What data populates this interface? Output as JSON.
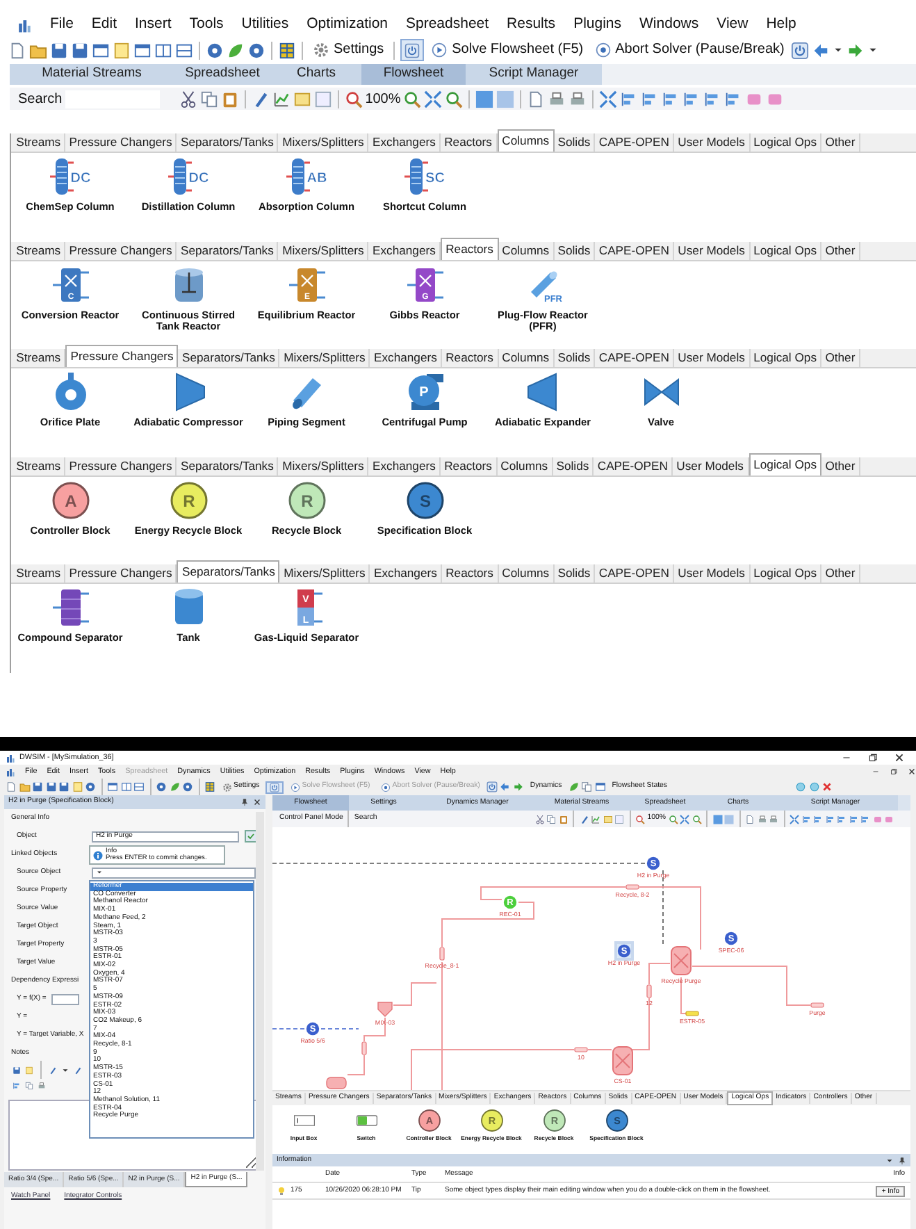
{
  "upper_window": {
    "menu": [
      "File",
      "Edit",
      "Insert",
      "Tools",
      "Utilities",
      "Optimization",
      "Spreadsheet",
      "Results",
      "Plugins",
      "Windows",
      "View",
      "Help"
    ],
    "toolbar": [
      "Settings",
      "Solve Flowsheet (F5)",
      "Abort Solver (Pause/Break)"
    ],
    "document_tabs": [
      {
        "label": "Material Streams",
        "selected": false
      },
      {
        "label": "Spreadsheet",
        "selected": false
      },
      {
        "label": "Charts",
        "selected": false
      },
      {
        "label": "Flowsheet",
        "selected": true
      },
      {
        "label": "Script Manager",
        "selected": false
      }
    ],
    "search_label": "Search",
    "zoom": "100%",
    "palettes": [
      {
        "tabs": [
          {
            "label": "Streams",
            "selected": false
          },
          {
            "label": "Pressure Changers",
            "selected": false
          },
          {
            "label": "Separators/Tanks",
            "selected": false
          },
          {
            "label": "Mixers/Splitters",
            "selected": false
          },
          {
            "label": "Exchangers",
            "selected": false
          },
          {
            "label": "Reactors",
            "selected": false
          },
          {
            "label": "Columns",
            "selected": true
          },
          {
            "label": "Solids",
            "selected": false
          },
          {
            "label": "CAPE-OPEN",
            "selected": false
          },
          {
            "label": "User Models",
            "selected": false
          },
          {
            "label": "Logical Ops",
            "selected": false
          },
          {
            "label": "Other",
            "selected": false
          }
        ],
        "items": [
          {
            "kind": "column",
            "glyphs": [
              "DC"
            ],
            "label": "ChemSep Column"
          },
          {
            "kind": "column",
            "glyphs": [
              "DC"
            ],
            "label": "Distillation Column"
          },
          {
            "kind": "column",
            "glyphs": [
              "AB"
            ],
            "label": "Absorption Column"
          },
          {
            "kind": "column",
            "glyphs": [
              "SC"
            ],
            "label": "Shortcut Column"
          }
        ]
      },
      {
        "tabs": [
          {
            "label": "Streams",
            "selected": false
          },
          {
            "label": "Pressure Changers",
            "selected": false
          },
          {
            "label": "Separators/Tanks",
            "selected": false
          },
          {
            "label": "Mixers/Splitters",
            "selected": false
          },
          {
            "label": "Exchangers",
            "selected": false
          },
          {
            "label": "Reactors",
            "selected": true
          },
          {
            "label": "Columns",
            "selected": false
          },
          {
            "label": "Solids",
            "selected": false
          },
          {
            "label": "CAPE-OPEN",
            "selected": false
          },
          {
            "label": "User Models",
            "selected": false
          },
          {
            "label": "Logical Ops",
            "selected": false
          },
          {
            "label": "Other",
            "selected": false
          }
        ],
        "items": [
          {
            "kind": "reactor",
            "color": "#3d78c0",
            "glyphs": [
              "C"
            ],
            "label": "Conversion Reactor"
          },
          {
            "kind": "stirred-tank",
            "label": "Continuous Stirred Tank Reactor"
          },
          {
            "kind": "reactor",
            "color": "#c8882c",
            "glyphs": [
              "E"
            ],
            "label": "Equilibrium Reactor"
          },
          {
            "kind": "reactor",
            "color": "#9448c8",
            "glyphs": [
              "G"
            ],
            "label": "Gibbs Reactor"
          },
          {
            "kind": "tube",
            "glyphs": [
              "PFR"
            ],
            "label": "Plug-Flow Reactor (PFR)"
          }
        ]
      },
      {
        "tabs": [
          {
            "label": "Streams",
            "selected": false
          },
          {
            "label": "Pressure Changers",
            "selected": true
          },
          {
            "label": "Separators/Tanks",
            "selected": false
          },
          {
            "label": "Mixers/Splitters",
            "selected": false
          },
          {
            "label": "Exchangers",
            "selected": false
          },
          {
            "label": "Reactors",
            "selected": false
          },
          {
            "label": "Columns",
            "selected": false
          },
          {
            "label": "Solids",
            "selected": false
          },
          {
            "label": "CAPE-OPEN",
            "selected": false
          },
          {
            "label": "User Models",
            "selected": false
          },
          {
            "label": "Logical Ops",
            "selected": false
          },
          {
            "label": "Other",
            "selected": false
          }
        ],
        "items": [
          {
            "kind": "orifice",
            "label": "Orifice Plate"
          },
          {
            "kind": "compressor",
            "label": "Adiabatic Compressor"
          },
          {
            "kind": "pipe",
            "label": "Piping Segment"
          },
          {
            "kind": "pump",
            "glyphs": [
              "P"
            ],
            "label": "Centrifugal Pump"
          },
          {
            "kind": "expander",
            "label": "Adiabatic Expander"
          },
          {
            "kind": "valve",
            "label": "Valve"
          }
        ]
      },
      {
        "tabs": [
          {
            "label": "Streams",
            "selected": false
          },
          {
            "label": "Pressure Changers",
            "selected": false
          },
          {
            "label": "Separators/Tanks",
            "selected": false
          },
          {
            "label": "Mixers/Splitters",
            "selected": false
          },
          {
            "label": "Exchangers",
            "selected": false
          },
          {
            "label": "Reactors",
            "selected": false
          },
          {
            "label": "Columns",
            "selected": false
          },
          {
            "label": "Solids",
            "selected": false
          },
          {
            "label": "CAPE-OPEN",
            "selected": false
          },
          {
            "label": "User Models",
            "selected": false
          },
          {
            "label": "Logical Ops",
            "selected": true
          },
          {
            "label": "Other",
            "selected": false
          }
        ],
        "items": [
          {
            "kind": "circle",
            "color": "#f7a0a0",
            "glyphs": [
              "A"
            ],
            "label": "Controller Block"
          },
          {
            "kind": "circle",
            "color": "#e8ec60",
            "glyphs": [
              "R"
            ],
            "label": "Energy Recycle Block"
          },
          {
            "kind": "circle",
            "color": "#bfe8b8",
            "glyphs": [
              "R"
            ],
            "label": "Recycle Block"
          },
          {
            "kind": "circle",
            "color": "#3c88d0",
            "glyphs": [
              "S"
            ],
            "label": "Specification Block"
          }
        ]
      },
      {
        "tabs": [
          {
            "label": "Streams",
            "selected": false
          },
          {
            "label": "Pressure Changers",
            "selected": false
          },
          {
            "label": "Separators/Tanks",
            "selected": true
          },
          {
            "label": "Mixers/Splitters",
            "selected": false
          },
          {
            "label": "Exchangers",
            "selected": false
          },
          {
            "label": "Reactors",
            "selected": false
          },
          {
            "label": "Columns",
            "selected": false
          },
          {
            "label": "Solids",
            "selected": false
          },
          {
            "label": "CAPE-OPEN",
            "selected": false
          },
          {
            "label": "User Models",
            "selected": false
          },
          {
            "label": "Logical Ops",
            "selected": false
          },
          {
            "label": "Other",
            "selected": false
          }
        ],
        "items": [
          {
            "kind": "separator",
            "label": "Compound Separator"
          },
          {
            "kind": "tank",
            "label": "Tank"
          },
          {
            "kind": "flash-drum",
            "glyphs": [
              "V",
              "L"
            ],
            "label": "Gas-Liquid Separator"
          }
        ]
      }
    ]
  },
  "lower_window": {
    "title": "DWSIM - [MySimulation_36]",
    "menu": [
      {
        "label": "File",
        "disabled": false
      },
      {
        "label": "Edit",
        "disabled": false
      },
      {
        "label": "Insert",
        "disabled": false
      },
      {
        "label": "Tools",
        "disabled": false
      },
      {
        "label": "Spreadsheet",
        "disabled": true
      },
      {
        "label": "Dynamics",
        "disabled": false
      },
      {
        "label": "Utilities",
        "disabled": false
      },
      {
        "label": "Optimization",
        "disabled": false
      },
      {
        "label": "Results",
        "disabled": false
      },
      {
        "label": "Plugins",
        "disabled": false
      },
      {
        "label": "Windows",
        "disabled": false
      },
      {
        "label": "View",
        "disabled": false
      },
      {
        "label": "Help",
        "disabled": false
      }
    ],
    "toolbar": [
      {
        "label": "Settings",
        "disabled": false
      },
      {
        "label": "Solve Flowsheet (F5)",
        "disabled": true
      },
      {
        "label": "Abort Solver (Pause/Break)",
        "disabled": true
      },
      {
        "label": "Dynamics",
        "disabled": false
      },
      {
        "label": "Flowsheet States",
        "disabled": false
      }
    ],
    "editor": {
      "title": "H2 in Purge (Specification Block)",
      "rows": [
        {
          "kind": "section",
          "label": "General Info"
        },
        {
          "kind": "object",
          "label": "Object",
          "value": "H2 in Purge"
        },
        {
          "kind": "section",
          "label": "Linked Objects"
        },
        {
          "kind": "combo",
          "label": "Source Object"
        },
        {
          "kind": "label",
          "label": "Source Property"
        },
        {
          "kind": "label",
          "label": "Source Value"
        },
        {
          "kind": "label",
          "label": "Target Object"
        },
        {
          "kind": "label",
          "label": "Target Property"
        },
        {
          "kind": "label",
          "label": "Target Value"
        },
        {
          "kind": "section",
          "label": "Dependency Expressi"
        },
        {
          "kind": "formula",
          "label": "Y = f(X) ="
        },
        {
          "kind": "label",
          "label": "Y ="
        },
        {
          "kind": "label",
          "label": "Y = Target Variable, X"
        },
        {
          "kind": "section",
          "label": "Notes"
        }
      ],
      "tooltip": {
        "title": "Info",
        "message": "Press ENTER to commit changes."
      },
      "dropdown": [
        {
          "label": "Reformer",
          "selected": true
        },
        {
          "label": "CO Converter",
          "selected": false
        },
        {
          "label": "Methanol Reactor",
          "selected": false
        },
        {
          "label": "MIX-01",
          "selected": false
        },
        {
          "label": "Methane Feed, 2",
          "selected": false
        },
        {
          "label": "Steam, 1",
          "selected": false
        },
        {
          "label": "MSTR-03",
          "selected": false
        },
        {
          "label": "3",
          "selected": false
        },
        {
          "label": "MSTR-05",
          "selected": false
        },
        {
          "label": "ESTR-01",
          "selected": false
        },
        {
          "label": "MIX-02",
          "selected": false
        },
        {
          "label": "Oxygen, 4",
          "selected": false
        },
        {
          "label": "MSTR-07",
          "selected": false
        },
        {
          "label": "5",
          "selected": false
        },
        {
          "label": "MSTR-09",
          "selected": false
        },
        {
          "label": "ESTR-02",
          "selected": false
        },
        {
          "label": "MIX-03",
          "selected": false
        },
        {
          "label": "CO2 Makeup, 6",
          "selected": false
        },
        {
          "label": "7",
          "selected": false
        },
        {
          "label": "MIX-04",
          "selected": false
        },
        {
          "label": "Recycle, 8-1",
          "selected": false
        },
        {
          "label": "9",
          "selected": false
        },
        {
          "label": "10",
          "selected": false
        },
        {
          "label": "MSTR-15",
          "selected": false
        },
        {
          "label": "ESTR-03",
          "selected": false
        },
        {
          "label": "CS-01",
          "selected": false
        },
        {
          "label": "12",
          "selected": false
        },
        {
          "label": "Methanol Solution, 11",
          "selected": false
        },
        {
          "label": "ESTR-04",
          "selected": false
        },
        {
          "label": "Recycle Purge",
          "selected": false
        }
      ],
      "tabs": [
        {
          "label": "Ratio 3/4 (Spe...",
          "selected": false
        },
        {
          "label": "Ratio 5/6 (Spe...",
          "selected": false
        },
        {
          "label": "N2 in Purge (S...",
          "selected": false
        },
        {
          "label": "H2 in Purge (S...",
          "selected": true
        }
      ],
      "footer_tabs": [
        "Watch Panel",
        "Integrator Controls"
      ]
    },
    "document_tabs": [
      {
        "label": "Flowsheet",
        "selected": true
      },
      {
        "label": "Settings",
        "selected": false
      },
      {
        "label": "Dynamics Manager",
        "selected": false
      },
      {
        "label": "Material Streams",
        "selected": false
      },
      {
        "label": "Spreadsheet",
        "selected": false
      },
      {
        "label": "Charts",
        "selected": false
      },
      {
        "label": "Script Manager",
        "selected": false
      }
    ],
    "canvas_toolbar": {
      "mode": "Control Panel Mode",
      "search_label": "Search",
      "zoom": "100%"
    },
    "flowsheet": {
      "nodes": [
        {
          "kind": "spec",
          "glyphs": [
            "S"
          ],
          "label": "H2 in Purge",
          "selected": false
        },
        {
          "kind": "stream",
          "label": "Recycle, 8-2",
          "selected": false
        },
        {
          "kind": "recycle",
          "glyphs": [
            "R"
          ],
          "label": "REC-01",
          "selected": false
        },
        {
          "kind": "spec",
          "glyphs": [
            "S"
          ],
          "label": "H2 in Purge",
          "selected": true
        },
        {
          "kind": "spec",
          "glyphs": [
            "S"
          ],
          "label": "SPEC-06",
          "selected": false
        },
        {
          "kind": "vessel",
          "label": "Recycle Purge",
          "selected": false
        },
        {
          "kind": "energy",
          "label": "ESTR-05",
          "selected": false
        },
        {
          "kind": "stream",
          "label": "Purge",
          "selected": false
        },
        {
          "kind": "stream-v",
          "label": "12",
          "selected": false
        },
        {
          "kind": "vessel",
          "label": "CS-01",
          "selected": false
        },
        {
          "kind": "stream",
          "label": "10",
          "selected": false
        },
        {
          "kind": "spec",
          "glyphs": [
            "S"
          ],
          "label": "Ratio 5/6",
          "selected": false
        },
        {
          "kind": "mixer",
          "label": "MIX-03",
          "selected": false
        },
        {
          "kind": "stream-v",
          "selected": false
        },
        {
          "kind": "stream-v",
          "label": "Recycle_8-1",
          "selected": false
        },
        {
          "kind": "drum",
          "selected": false
        }
      ]
    },
    "palette": {
      "tabs": [
        {
          "label": "Streams",
          "selected": false
        },
        {
          "label": "Pressure Changers",
          "selected": false
        },
        {
          "label": "Separators/Tanks",
          "selected": false
        },
        {
          "label": "Mixers/Splitters",
          "selected": false
        },
        {
          "label": "Exchangers",
          "selected": false
        },
        {
          "label": "Reactors",
          "selected": false
        },
        {
          "label": "Columns",
          "selected": false
        },
        {
          "label": "Solids",
          "selected": false
        },
        {
          "label": "CAPE-OPEN",
          "selected": false
        },
        {
          "label": "User Models",
          "selected": false
        },
        {
          "label": "Logical Ops",
          "selected": true
        },
        {
          "label": "Indicators",
          "selected": false
        },
        {
          "label": "Controllers",
          "selected": false
        },
        {
          "label": "Other",
          "selected": false
        }
      ],
      "items": [
        {
          "kind": "input-box",
          "label": "Input Box"
        },
        {
          "kind": "switch",
          "label": "Switch"
        },
        {
          "kind": "circle",
          "color": "#f7a0a0",
          "glyphs": [
            "A"
          ],
          "label": "Controller Block"
        },
        {
          "kind": "circle",
          "color": "#e8ec60",
          "glyphs": [
            "R"
          ],
          "label": "Energy Recycle Block"
        },
        {
          "kind": "circle",
          "color": "#bfe8b8",
          "glyphs": [
            "R"
          ],
          "label": "Recycle Block"
        },
        {
          "kind": "circle",
          "color": "#3c88d0",
          "glyphs": [
            "S"
          ],
          "label": "Specification Block"
        }
      ]
    },
    "information": {
      "title": "Information",
      "columns": [
        "Date",
        "Type",
        "Message",
        "Info"
      ],
      "rows": [
        {
          "number": "175",
          "date": "10/26/2020 06:28:10 PM",
          "type": "Tip",
          "message": "Some object types display their main editing window when you do a double-click on them in the flowsheet.",
          "action": "+ Info"
        }
      ]
    }
  }
}
